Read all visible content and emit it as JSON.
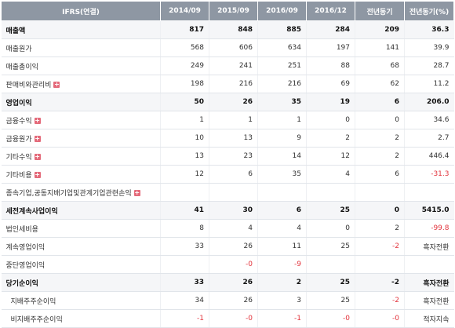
{
  "headers": [
    "IFRS(연결)",
    "2014/09",
    "2015/09",
    "2016/09",
    "2016/12",
    "전년동기",
    "전년동기(%)"
  ],
  "rows": [
    {
      "label": "매출액",
      "bold": true,
      "plus": false,
      "values": [
        "817",
        "848",
        "885",
        "284",
        "209",
        "36.3"
      ],
      "neg": [
        false,
        false,
        false,
        false,
        false,
        false
      ]
    },
    {
      "label": "매출원가",
      "bold": false,
      "plus": false,
      "values": [
        "568",
        "606",
        "634",
        "197",
        "141",
        "39.9"
      ],
      "neg": [
        false,
        false,
        false,
        false,
        false,
        false
      ]
    },
    {
      "label": "매출총이익",
      "bold": false,
      "plus": false,
      "values": [
        "249",
        "241",
        "251",
        "88",
        "68",
        "28.7"
      ],
      "neg": [
        false,
        false,
        false,
        false,
        false,
        false
      ]
    },
    {
      "label": "판매비와관리비",
      "bold": false,
      "plus": true,
      "values": [
        "198",
        "216",
        "216",
        "69",
        "62",
        "11.2"
      ],
      "neg": [
        false,
        false,
        false,
        false,
        false,
        false
      ]
    },
    {
      "label": "영업이익",
      "bold": true,
      "plus": false,
      "values": [
        "50",
        "26",
        "35",
        "19",
        "6",
        "206.0"
      ],
      "neg": [
        false,
        false,
        false,
        false,
        false,
        false
      ]
    },
    {
      "label": "금융수익",
      "bold": false,
      "plus": true,
      "values": [
        "1",
        "1",
        "1",
        "0",
        "0",
        "34.6"
      ],
      "neg": [
        false,
        false,
        false,
        false,
        false,
        false
      ]
    },
    {
      "label": "금융원가",
      "bold": false,
      "plus": true,
      "values": [
        "10",
        "13",
        "9",
        "2",
        "2",
        "2.7"
      ],
      "neg": [
        false,
        false,
        false,
        false,
        false,
        false
      ]
    },
    {
      "label": "기타수익",
      "bold": false,
      "plus": true,
      "values": [
        "13",
        "23",
        "14",
        "12",
        "2",
        "446.4"
      ],
      "neg": [
        false,
        false,
        false,
        false,
        false,
        false
      ]
    },
    {
      "label": "기타비용",
      "bold": false,
      "plus": true,
      "values": [
        "12",
        "6",
        "35",
        "4",
        "6",
        "-31.3"
      ],
      "neg": [
        false,
        false,
        false,
        false,
        false,
        true
      ]
    },
    {
      "label": "종속기업,공동지배기업및관계기업관련손익",
      "bold": false,
      "plus": true,
      "values": [
        "",
        "",
        "",
        "",
        "",
        ""
      ],
      "neg": [
        false,
        false,
        false,
        false,
        false,
        false
      ]
    },
    {
      "label": "세전계속사업이익",
      "bold": true,
      "plus": false,
      "values": [
        "41",
        "30",
        "6",
        "25",
        "0",
        "5415.0"
      ],
      "neg": [
        false,
        false,
        false,
        false,
        false,
        false
      ]
    },
    {
      "label": "법인세비용",
      "bold": false,
      "plus": false,
      "values": [
        "8",
        "4",
        "4",
        "0",
        "2",
        "-99.8"
      ],
      "neg": [
        false,
        false,
        false,
        false,
        false,
        true
      ]
    },
    {
      "label": "계속영업이익",
      "bold": false,
      "plus": false,
      "values": [
        "33",
        "26",
        "11",
        "25",
        "-2",
        "흑자전환"
      ],
      "neg": [
        false,
        false,
        false,
        false,
        true,
        false
      ]
    },
    {
      "label": "중단영업이익",
      "bold": false,
      "plus": false,
      "values": [
        "",
        "-0",
        "-9",
        "",
        "",
        ""
      ],
      "neg": [
        false,
        true,
        true,
        false,
        false,
        false
      ]
    },
    {
      "label": "당기순이익",
      "bold": true,
      "plus": false,
      "values": [
        "33",
        "26",
        "2",
        "25",
        "-2",
        "흑자전환"
      ],
      "neg": [
        false,
        false,
        false,
        false,
        true,
        false
      ]
    },
    {
      "label": "지배주주순이익",
      "bold": false,
      "plus": false,
      "sub": true,
      "values": [
        "34",
        "26",
        "3",
        "25",
        "-2",
        "흑자전환"
      ],
      "neg": [
        false,
        false,
        false,
        false,
        true,
        false
      ]
    },
    {
      "label": "비지배주주순이익",
      "bold": false,
      "plus": false,
      "sub": true,
      "values": [
        "-1",
        "-0",
        "-1",
        "-0",
        "-0",
        "적자지속"
      ],
      "neg": [
        true,
        true,
        true,
        true,
        true,
        false
      ]
    }
  ],
  "plus_glyph": "+",
  "colors": {
    "header_bg": "#8e97a3",
    "negative": "#e2333c",
    "plus_badge": "#e46a7a"
  }
}
